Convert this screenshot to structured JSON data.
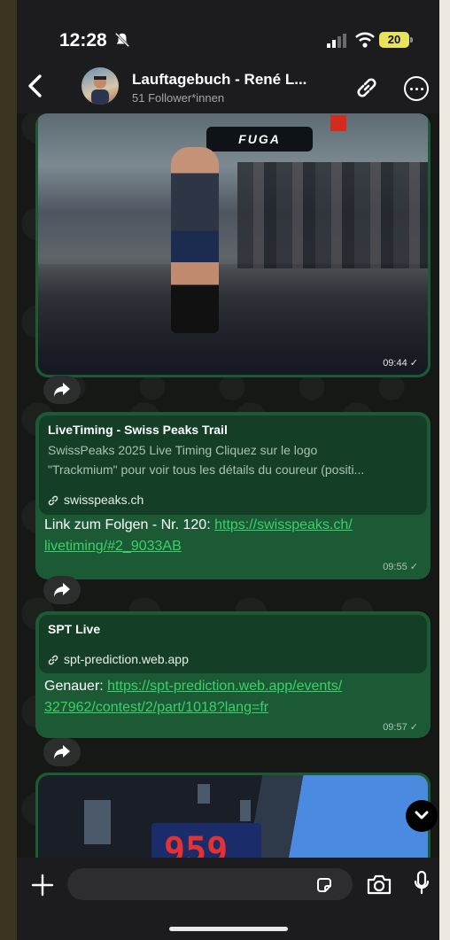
{
  "status_bar": {
    "time": "12:28",
    "battery": "20"
  },
  "header": {
    "title": "Lauftagebuch - René L...",
    "subtitle": "51 Follower*innen"
  },
  "messages": {
    "photo1": {
      "time": "09:44"
    },
    "msg1": {
      "preview_title": "LiveTiming - Swiss Peaks Trail",
      "preview_desc_line1": "SwissPeaks 2025 Live Timing Cliquez sur le logo",
      "preview_desc_line2": "\"Trackmium\" pour voir tous les détails du coureur (positi...",
      "preview_domain": "swisspeaks.ch",
      "text_prefix": "Link zum Folgen - Nr. 120: ",
      "link_part1": "https://swisspeaks.ch/",
      "link_part2": "livetiming/#2_9033AB",
      "time": "09:55"
    },
    "msg2": {
      "preview_title": "SPT Live",
      "preview_domain": "spt-prediction.web.app",
      "text_prefix": "Genauer: ",
      "link_part1": "https://spt-prediction.web.app/events/",
      "link_part2": "327962/contest/2/part/1018?lang=fr",
      "time": "09:57"
    },
    "photo2": {
      "sign_text": "959"
    }
  },
  "composer": {
    "placeholder": ""
  },
  "photo1_banner": "FUGA",
  "colors": {
    "bubble": "#1c5a35",
    "link": "#3ad16a",
    "background": "#121412"
  }
}
